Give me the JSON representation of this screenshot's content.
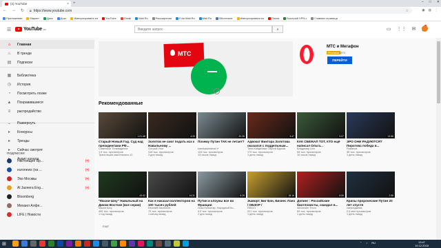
{
  "browser": {
    "tab_title": "(2) YouTube",
    "new_tab": "+",
    "url": "https://www.youtube.com",
    "bookmarks": [
      {
        "label": "Приложения",
        "color": "#4285f4"
      },
      {
        "label": "Маркет",
        "color": "#f4b400"
      },
      {
        "label": "Диск",
        "color": "#0f9d58"
      },
      {
        "label": "Докс",
        "color": "#4285f4"
      },
      {
        "label": "Импортировано из",
        "color": "#f4b400"
      },
      {
        "label": "YouTube",
        "color": "#ff0000"
      },
      {
        "label": "Gmail",
        "color": "#ea4335"
      },
      {
        "label": "Mail.Ru",
        "color": "#168de2"
      },
      {
        "label": "Расширения",
        "color": "#888888"
      },
      {
        "label": "Foto.Mail.Ru",
        "color": "#168de2"
      },
      {
        "label": "Mail.Ru",
        "color": "#168de2"
      },
      {
        "label": "ВКонтакте",
        "color": "#4a76a8"
      },
      {
        "label": "Импортировано из",
        "color": "#f4b400"
      },
      {
        "label": "Поиск",
        "color": "#ff0000"
      },
      {
        "label": "Быстрый VPN с",
        "color": "#2e7d32"
      },
      {
        "label": "Главная страница",
        "color": "#888888"
      }
    ]
  },
  "youtube": {
    "logo": "YouTube",
    "region": "RU",
    "search_placeholder": "Введите запрос",
    "notifications": "9"
  },
  "sidebar": {
    "items": [
      {
        "label": "Главная",
        "icon": "home-icon",
        "glyph": "⌂",
        "active": true
      },
      {
        "label": "В тренде",
        "icon": "fire-icon",
        "glyph": "♨"
      },
      {
        "label": "Подписки",
        "icon": "subscriptions-icon",
        "glyph": "▤"
      },
      {
        "label": "Библиотека",
        "icon": "folder-icon",
        "glyph": "▦"
      },
      {
        "label": "История",
        "icon": "history-icon",
        "glyph": "◷"
      },
      {
        "label": "Посмотреть позже",
        "icon": "clock-icon",
        "glyph": "◔"
      },
      {
        "label": "Понравившиеся",
        "icon": "thumb-up-icon",
        "glyph": "▲"
      },
      {
        "label": "распродайство",
        "icon": "list-icon",
        "glyph": "≡"
      },
      {
        "label": "Развернуть",
        "icon": "chevron-down-icon",
        "glyph": "⌄"
      },
      {
        "label": "Конкурсы",
        "icon": "playlist-icon",
        "glyph": "▸"
      },
      {
        "label": "Тренды",
        "icon": "playlist-icon",
        "glyph": "▸"
      },
      {
        "label": "Сейчас смотрят",
        "icon": "playlist-icon",
        "glyph": "▸"
      },
      {
        "label": "Аудит канала",
        "icon": "playlist-icon",
        "glyph": "▸"
      }
    ],
    "subscriptions_header": "ПОДПИСКИ",
    "subscriptions": [
      {
        "label": "Настоящее Вр...",
        "color": "#1e3a6e"
      },
      {
        "label": "euronews (на ...",
        "color": "#1a4fa0"
      },
      {
        "label": "Эхо Москвы",
        "color": "#c62828"
      },
      {
        "label": "Al Jazeera Eng...",
        "color": "#e6a020"
      },
      {
        "label": "Bloomberg",
        "color": "#222222"
      },
      {
        "label": "Михаил Алфе...",
        "color": "#8d6e63"
      },
      {
        "label": "LIFE | Новости",
        "color": "#d32f2f"
      }
    ],
    "live_mark": "(•)"
  },
  "ad": {
    "brand_text": "МТС",
    "title": "МТС и Мегафон",
    "badge": "Реклама",
    "url": "МТС",
    "button": "ПЕРЕЙТИ"
  },
  "section_title": "Рекомендованные",
  "videos": [
    {
      "title": "Старый Новый Год. Суд над президентами РФ...",
      "channel": "Советское Телевидение",
      "views": "1,5 тыс. просмотров",
      "age": "Трансляция закончилась 12",
      "dur": "1:01:48",
      "bg": "#5a4a3a"
    },
    {
      "title": "Золотов не смог подать иск к Навальному ...",
      "channel": "Острый Угол",
      "views": "318 тыс. просмотров",
      "age": "3 дня назад",
      "dur": "4:33",
      "bg": "#3a2a20"
    },
    {
      "title": "Почему Путин ТАК не летает?",
      "channel": "kamikadzedead ✔",
      "views": "119 тыс. просмотров",
      "age": "13 часов назад",
      "dur": "20:28",
      "bg": "#7a8a90"
    },
    {
      "title": "Адвокат Виктора Золотова оказался с поддельным...",
      "channel": "Тина Канделаки Сергей Бурков",
      "views": "179 тыс. просмотров",
      "age": "1 день назад",
      "dur": "3:47",
      "bg": "#6a2a1a"
    },
    {
      "title": "КАК СБЕЖАЛ ТОТ, КТО ещё написал Ольга...",
      "channel": "Владимир Live",
      "views": "69 тыс. просмотров",
      "age": "16 часов назад",
      "dur": "9:07",
      "bg": "#3a5a3a"
    },
    {
      "title": "ЭРО ОНИ РАДУЮТСЯ? Пирогова победа в...",
      "channel": "Романов",
      "views": "35 тыс. просмотров",
      "age": "1 день назад",
      "dur": "13:58",
      "bg": "#2a3a5a"
    },
    {
      "title": "\"Маски-Шоу\" Навальный на Диком Востоке (все серии)",
      "channel": "Маски Шоу",
      "views": "455 тыс. просмотров",
      "age": "1 год назад",
      "dur": "43:42",
      "bg": "#1f3a1f"
    },
    {
      "title": "Как я наказал коллекторов на 100 тысяч рублей",
      "channel": "Евгений Васильев",
      "views": "79 тыс. просмотров",
      "age": "1 месяц назад",
      "dur": "14:31",
      "bg": "#4a4a4a"
    },
    {
      "title": "Путин и клоуны все во Франции",
      "channel": "Лиза Кононгар. Народный Ко...",
      "views": "5,5 тыс. просмотров",
      "age": "2 дня назад",
      "dur": "6:25",
      "bg": "#8a9aa0"
    },
    {
      "title": "Эшворт, Биг Бэн, Бизнес Ланч / ОБЗОР /",
      "channel": "RED21",
      "views": "221 тыс. просмотров",
      "age": "1 день назад",
      "dur": "18:16",
      "bg": "#c8a030"
    },
    {
      "title": "Допинг : Российские биатлонисты, скандал в...",
      "channel": "Alexander Thom",
      "views": "69 тыс. просмотров",
      "age": "1 день назад",
      "dur": "8:59",
      "bg": "#b02020"
    },
    {
      "title": "Кризы пророческие Путин 20 лет спустя",
      "channel": "свергаджева",
      "views": "2,6 млн просмотров",
      "age": "1 день назад",
      "dur": "2:58",
      "bg": "#203040"
    }
  ],
  "more": "ЕЩЁ",
  "taskbar": {
    "lang": "RU",
    "time": "13:47",
    "date": "19.12.2018",
    "apps": [
      "#f0a020",
      "#3a7bd5",
      "#666666",
      "#e53935",
      "#2e7d32",
      "#0d47a1",
      "#7b1fa2",
      "#ff6f00",
      "#c62828",
      "#1e88e5",
      "#455a64",
      "#43a047",
      "#fb8c00",
      "#5e35b1",
      "#d81b60",
      "#00897b",
      "#6d4c41",
      "#546e7a",
      "#c0ca33",
      "#039be5"
    ]
  }
}
